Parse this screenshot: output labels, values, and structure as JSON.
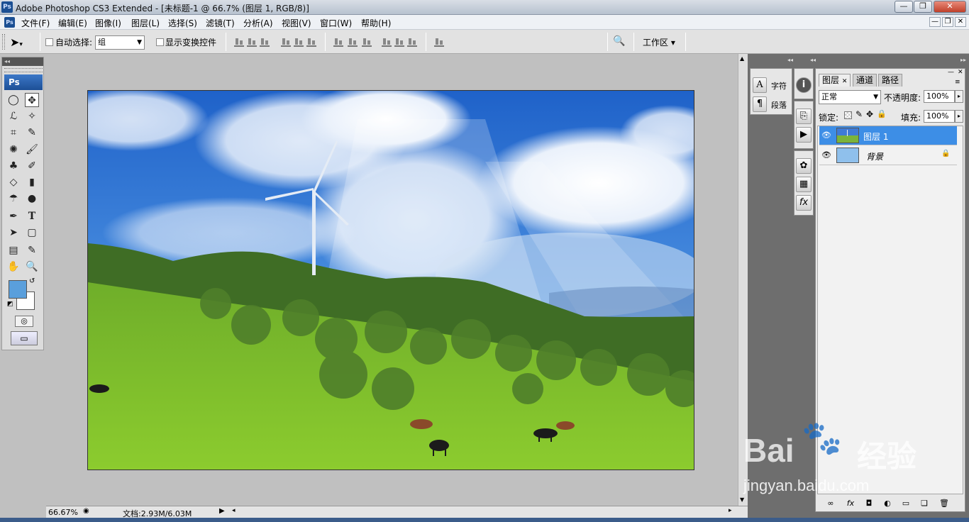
{
  "app": {
    "title": "Adobe Photoshop CS3 Extended - [未标题-1 @ 66.7% (图层 1, RGB/8)]",
    "logo": "Ps"
  },
  "window_buttons": {
    "minimize": "—",
    "restore": "❐",
    "close": "✕"
  },
  "menu": [
    "文件(F)",
    "编辑(E)",
    "图像(I)",
    "图层(L)",
    "选择(S)",
    "滤镜(T)",
    "分析(A)",
    "视图(V)",
    "窗口(W)",
    "帮助(H)"
  ],
  "doc_buttons": {
    "minimize": "—",
    "restore": "❐",
    "close": "✕"
  },
  "options": {
    "auto_select_label": "自动选择:",
    "auto_select_value": "组",
    "show_transform_label": "显示变换控件",
    "workspace_label": "工作区"
  },
  "toolbox": {
    "logo": "Ps",
    "foreground_color": "#5a9fdc",
    "background_color": "#ffffff"
  },
  "statusbar": {
    "zoom": "66.67%",
    "doc_info": "文档:2.93M/6.03M"
  },
  "char_panel": {
    "character": "字符",
    "paragraph": "段落"
  },
  "layers_panel": {
    "tabs": [
      "图层",
      "通道",
      "路径"
    ],
    "blend_mode": "正常",
    "opacity_label": "不透明度:",
    "opacity_value": "100%",
    "lock_label": "锁定:",
    "fill_label": "填充:",
    "fill_value": "100%",
    "layers": [
      {
        "name": "图层 1",
        "selected": true
      },
      {
        "name": "背景",
        "selected": false,
        "locked": true
      }
    ]
  },
  "watermark": {
    "brand": "Bai",
    "brand_cn": "经验",
    "url": "jingyan.baidu.com"
  }
}
